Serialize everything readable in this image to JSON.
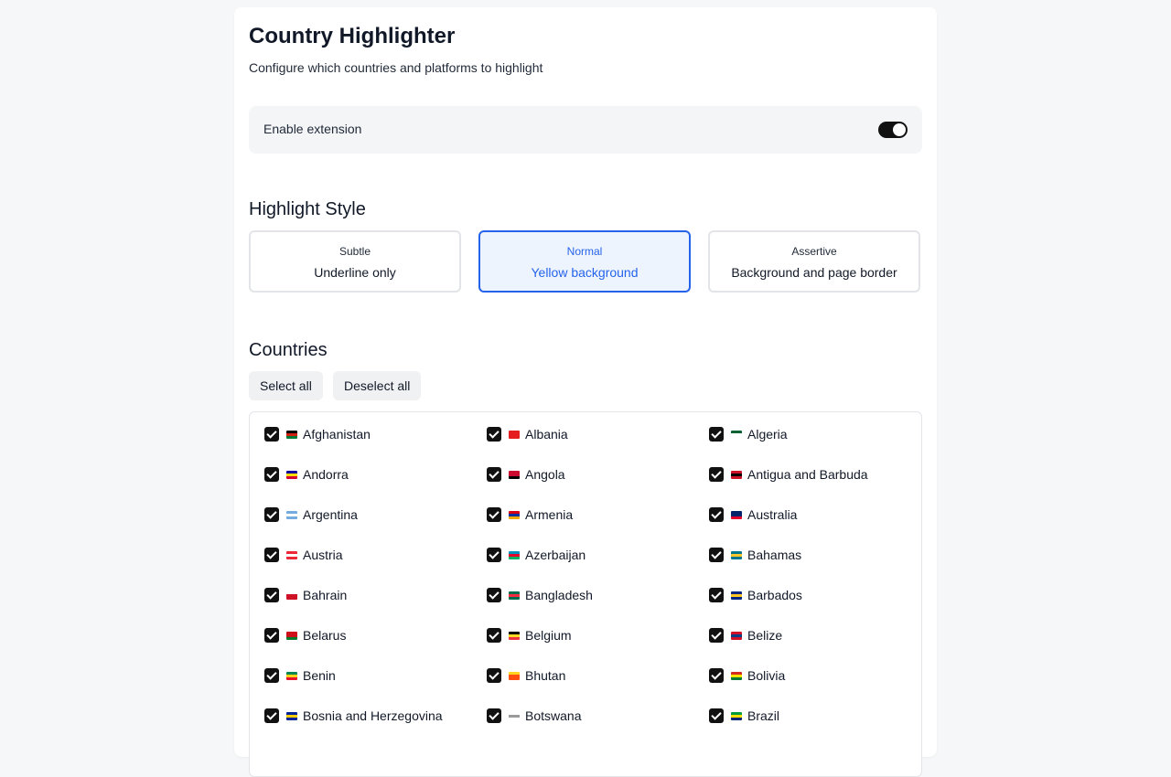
{
  "header": {
    "title": "Country Highlighter",
    "subtitle": "Configure which countries and platforms to highlight"
  },
  "enable": {
    "label": "Enable extension",
    "on": true
  },
  "highlight_style": {
    "title": "Highlight Style",
    "selected": "Normal",
    "options": [
      {
        "name": "Subtle",
        "desc": "Underline only"
      },
      {
        "name": "Normal",
        "desc": "Yellow background"
      },
      {
        "name": "Assertive",
        "desc": "Background and page border"
      }
    ]
  },
  "countries": {
    "title": "Countries",
    "select_all": "Select all",
    "deselect_all": "Deselect all",
    "items": [
      {
        "name": "Afghanistan",
        "flag_colors": [
          "#000000",
          "#d32011",
          "#007a36"
        ]
      },
      {
        "name": "Albania",
        "flag_colors": [
          "#e41e20",
          "#e41e20",
          "#e41e20"
        ]
      },
      {
        "name": "Algeria",
        "flag_colors": [
          "#006233",
          "#ffffff",
          "#ffffff"
        ]
      },
      {
        "name": "Andorra",
        "flag_colors": [
          "#10069f",
          "#fedf00",
          "#d50032"
        ]
      },
      {
        "name": "Angola",
        "flag_colors": [
          "#cc092f",
          "#cc092f",
          "#000000"
        ]
      },
      {
        "name": "Antigua and Barbuda",
        "flag_colors": [
          "#ce1126",
          "#000000",
          "#ce1126"
        ]
      },
      {
        "name": "Argentina",
        "flag_colors": [
          "#74acdf",
          "#ffffff",
          "#74acdf"
        ]
      },
      {
        "name": "Armenia",
        "flag_colors": [
          "#d90012",
          "#0033a0",
          "#f2a800"
        ]
      },
      {
        "name": "Australia",
        "flag_colors": [
          "#012169",
          "#012169",
          "#e4002b"
        ]
      },
      {
        "name": "Austria",
        "flag_colors": [
          "#ed2939",
          "#ffffff",
          "#ed2939"
        ]
      },
      {
        "name": "Azerbaijan",
        "flag_colors": [
          "#0092bc",
          "#e4002b",
          "#00af66"
        ]
      },
      {
        "name": "Bahamas",
        "flag_colors": [
          "#00778b",
          "#ffc72c",
          "#00778b"
        ]
      },
      {
        "name": "Bahrain",
        "flag_colors": [
          "#ffffff",
          "#ce1126",
          "#ce1126"
        ]
      },
      {
        "name": "Bangladesh",
        "flag_colors": [
          "#006a4e",
          "#f42a41",
          "#006a4e"
        ]
      },
      {
        "name": "Barbados",
        "flag_colors": [
          "#00267f",
          "#ffc726",
          "#00267f"
        ]
      },
      {
        "name": "Belarus",
        "flag_colors": [
          "#cf101a",
          "#cf101a",
          "#007d2c"
        ]
      },
      {
        "name": "Belgium",
        "flag_colors": [
          "#000000",
          "#fdda24",
          "#ef3340"
        ]
      },
      {
        "name": "Belize",
        "flag_colors": [
          "#ce1126",
          "#003f87",
          "#ce1126"
        ]
      },
      {
        "name": "Benin",
        "flag_colors": [
          "#008751",
          "#fcd116",
          "#e8112d"
        ]
      },
      {
        "name": "Bhutan",
        "flag_colors": [
          "#ffd520",
          "#ff4e12",
          "#ff4e12"
        ]
      },
      {
        "name": "Bolivia",
        "flag_colors": [
          "#d52b1e",
          "#f9e300",
          "#007934"
        ]
      },
      {
        "name": "Bosnia and Herzegovina",
        "flag_colors": [
          "#002395",
          "#fecb00",
          "#002395"
        ]
      },
      {
        "name": "Botswana",
        "flag_colors": [
          "#ffffff",
          "#9a9a9a",
          "#ffffff"
        ]
      },
      {
        "name": "Brazil",
        "flag_colors": [
          "#009c3b",
          "#ffdf00",
          "#002776"
        ]
      }
    ]
  }
}
